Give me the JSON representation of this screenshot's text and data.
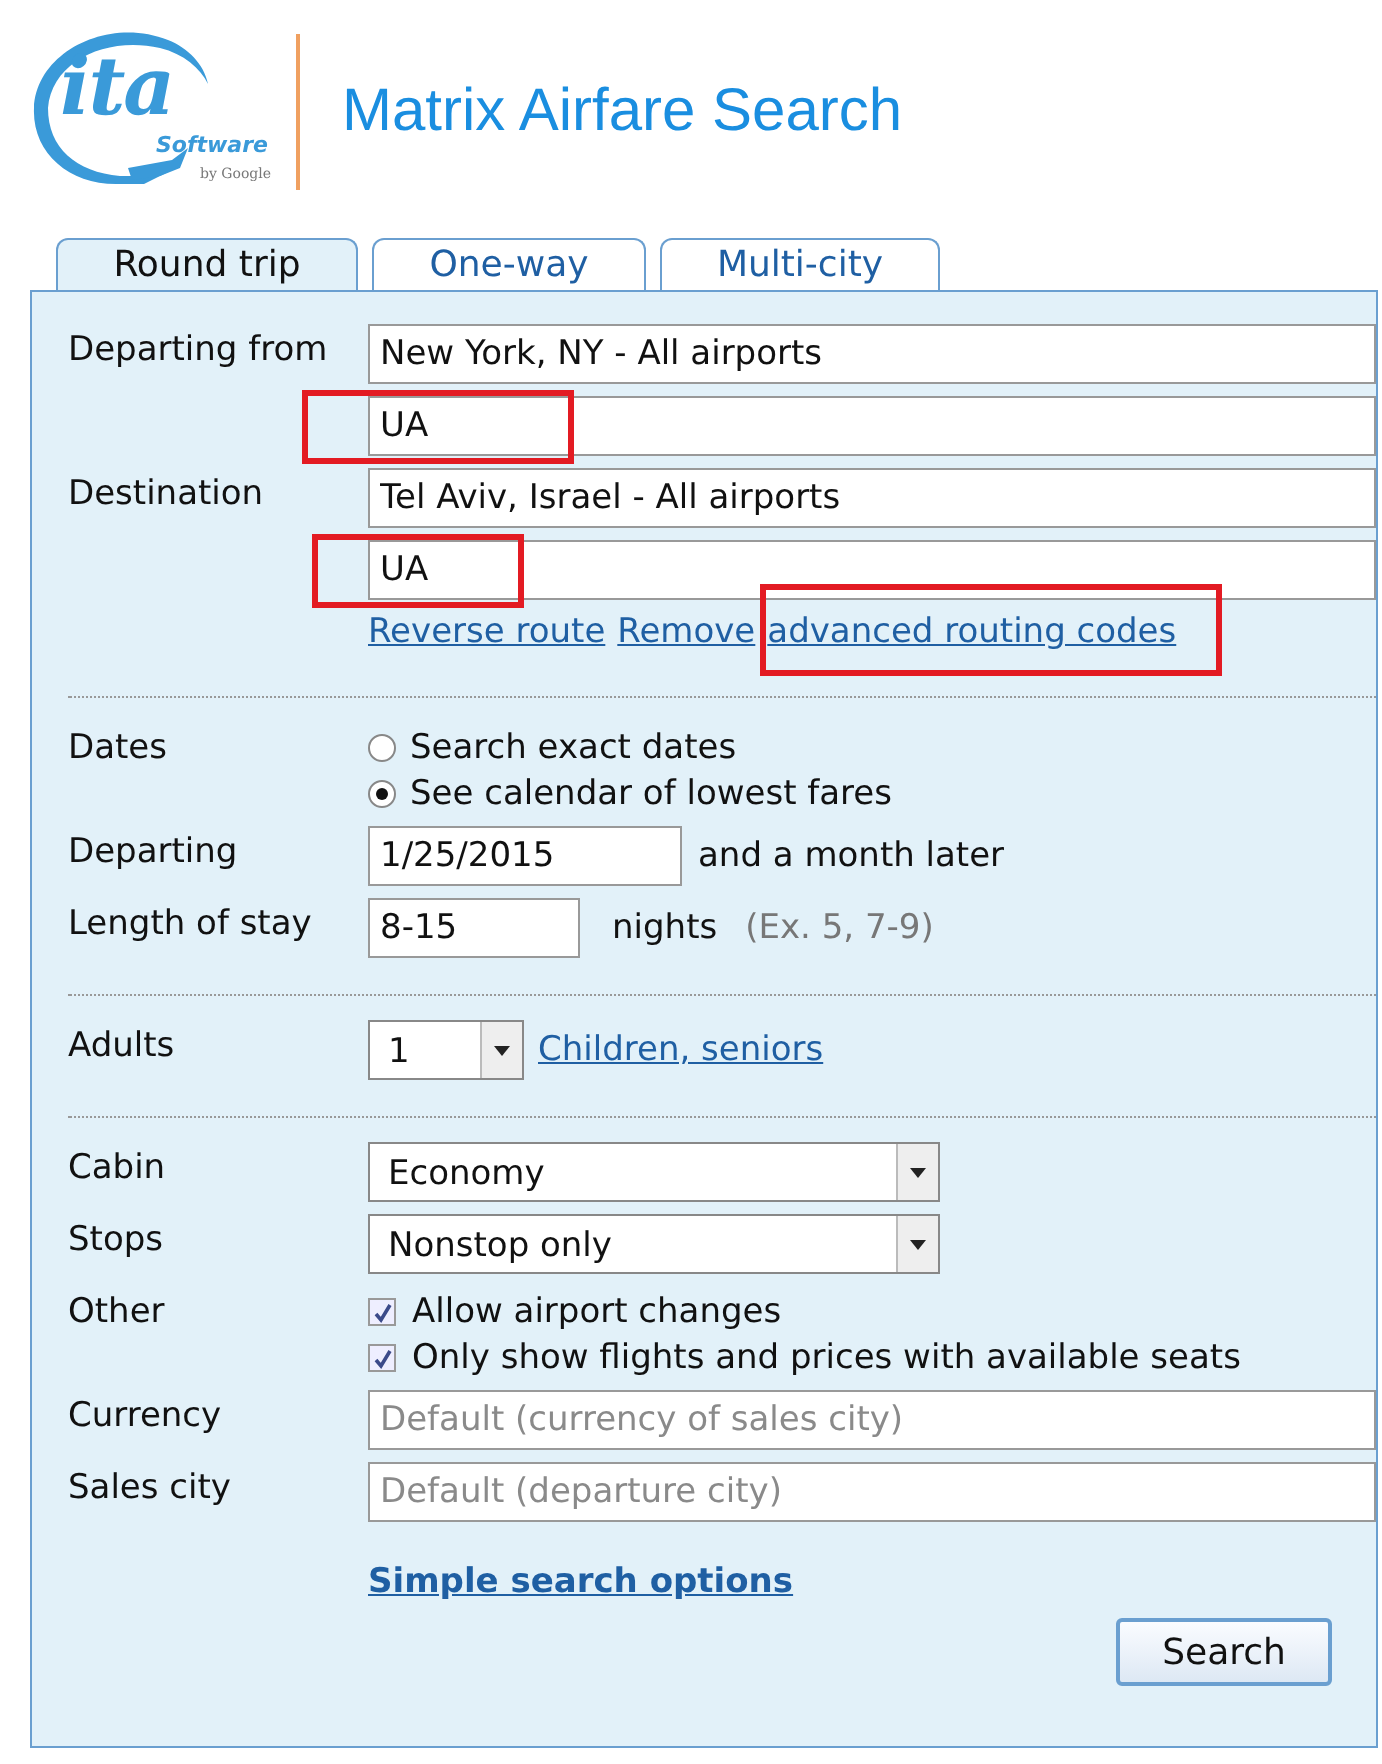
{
  "header": {
    "logo": {
      "mark": "ita",
      "word": "Software",
      "byline": "by Google"
    },
    "title": "Matrix Airfare Search"
  },
  "tabs": [
    {
      "label": "Round trip",
      "selected": true
    },
    {
      "label": "One-way",
      "selected": false
    },
    {
      "label": "Multi-city",
      "selected": false
    }
  ],
  "route": [
    {
      "label": "Departing from",
      "value": "New York, NY - All airports",
      "highlighted": false
    },
    {
      "value": "UA",
      "highlighted": true
    },
    {
      "label": "Destination",
      "value": "Tel Aviv, Israel - All airports",
      "highlighted": false
    },
    {
      "value": "UA",
      "highlighted": true
    }
  ],
  "route_links": [
    {
      "text": "Reverse route",
      "highlighted": false
    },
    {
      "text": "Remove",
      "highlighted": false
    },
    {
      "text": "advanced routing codes",
      "highlighted": true
    }
  ],
  "dates": {
    "label": "Dates",
    "options": [
      {
        "label": "Search exact dates",
        "selected": false
      },
      {
        "label": "See calendar of lowest fares",
        "selected": true
      }
    ]
  },
  "departing": {
    "label": "Departing",
    "value": "1/25/2015",
    "suffix": "and a month later"
  },
  "stay": {
    "label": "Length of stay",
    "value": "8-15",
    "unit": "nights",
    "hint": "(Ex. 5, 7-9)"
  },
  "adults": {
    "label": "Adults",
    "value": "1",
    "link": "Children, seniors"
  },
  "selects": [
    {
      "label": "Cabin",
      "value": "Economy"
    },
    {
      "label": "Stops",
      "value": "Nonstop only"
    }
  ],
  "other": {
    "label": "Other",
    "options": [
      {
        "label": "Allow airport changes",
        "checked": true
      },
      {
        "label": "Only show flights and prices with available seats",
        "checked": true
      }
    ]
  },
  "defaults": [
    {
      "label": "Currency",
      "placeholder": "Default (currency of sales city)"
    },
    {
      "label": "Sales city",
      "placeholder": "Default (departure city)"
    }
  ],
  "options_link": "Simple search options",
  "search_button": "Search"
}
